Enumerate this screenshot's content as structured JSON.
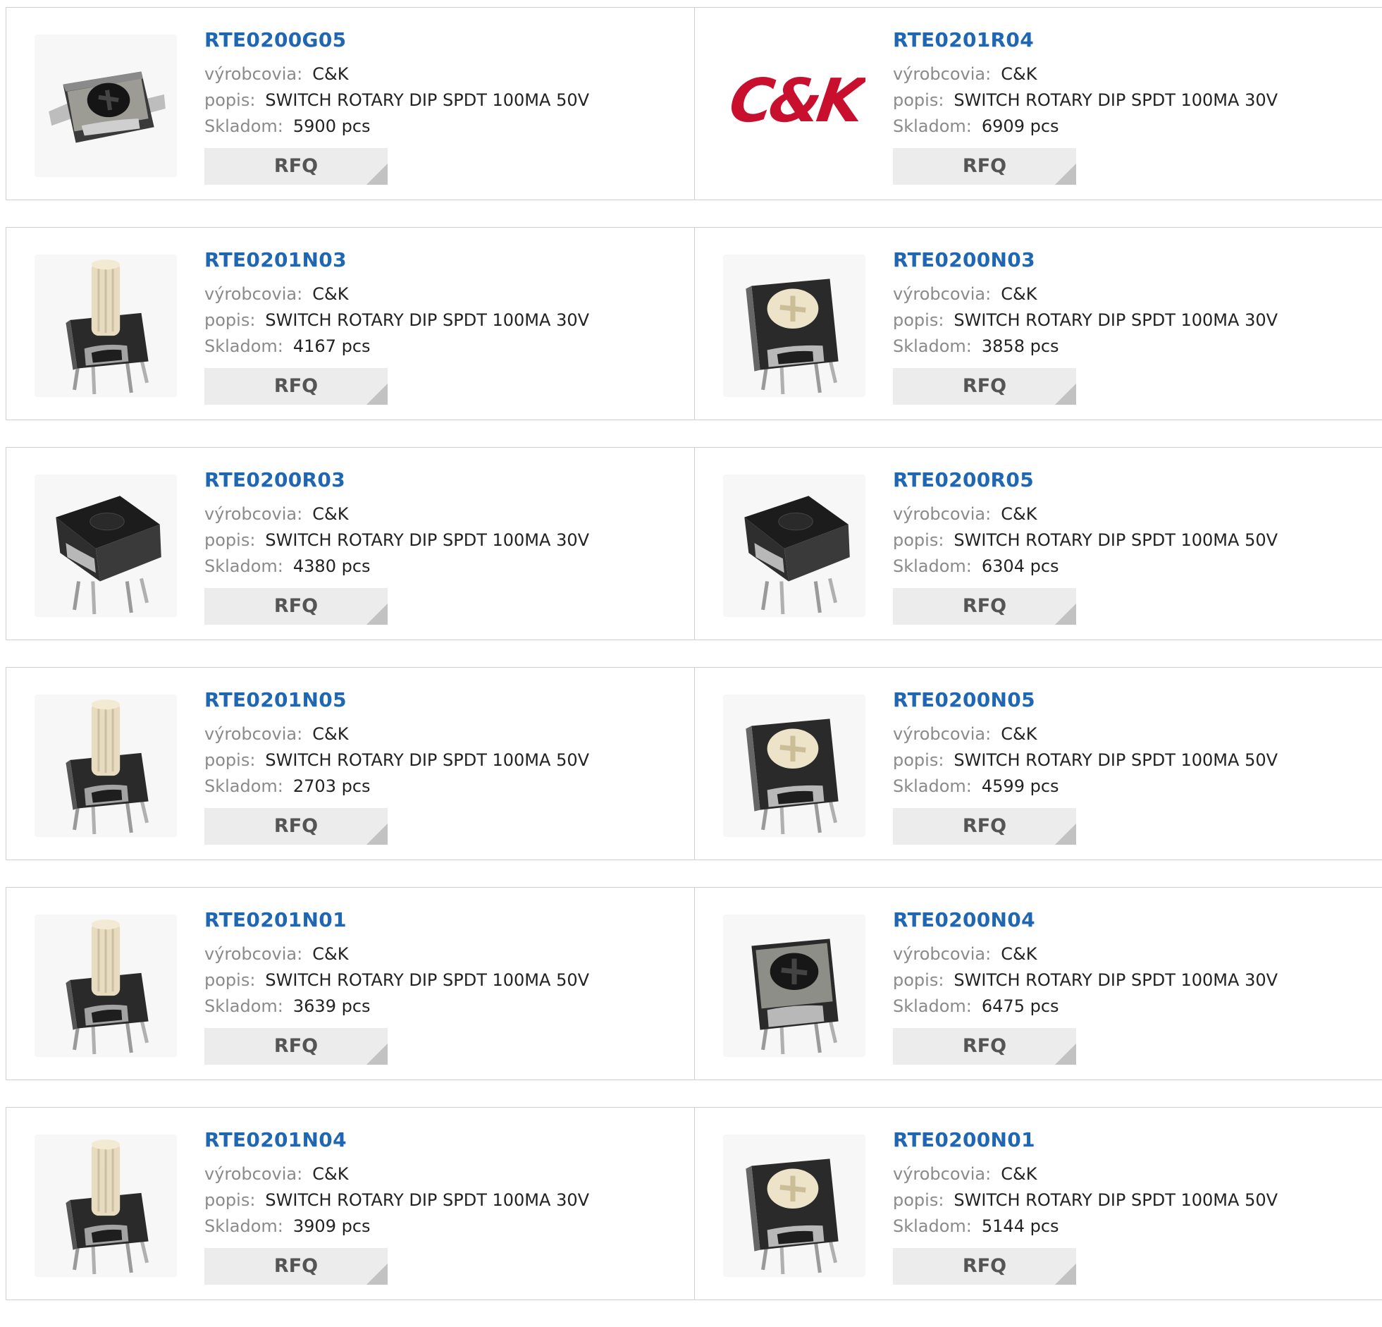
{
  "labels": {
    "manufacturer": "výrobcovia:",
    "description": "popis:",
    "stock": "Skladom:",
    "rfq": "RFQ"
  },
  "colors": {
    "part_link": "#1f66b3",
    "label_gray": "#8a8a8a",
    "button_bg": "#ececec",
    "brand_red": "#c8102e"
  },
  "products": [
    {
      "part": "RTE0200G05",
      "manufacturer": "C&K",
      "description": "SWITCH ROTARY DIP SPDT 100MA 50V",
      "stock": "5900 pcs",
      "image": "smd-switch-dark-knob"
    },
    {
      "part": "RTE0201R04",
      "manufacturer": "C&K",
      "description": "SWITCH ROTARY DIP SPDT 100MA 30V",
      "stock": "6909 pcs",
      "image": "ck-logo",
      "logo_text": "C&K"
    },
    {
      "part": "RTE0201N03",
      "manufacturer": "C&K",
      "description": "SWITCH ROTARY DIP SPDT 100MA 30V",
      "stock": "4167 pcs",
      "image": "tall-shaft-switch"
    },
    {
      "part": "RTE0200N03",
      "manufacturer": "C&K",
      "description": "SWITCH ROTARY DIP SPDT 100MA 30V",
      "stock": "3858 pcs",
      "image": "dip-switch-cream-knob"
    },
    {
      "part": "RTE0200R03",
      "manufacturer": "C&K",
      "description": "SWITCH ROTARY DIP SPDT 100MA 30V",
      "stock": "4380 pcs",
      "image": "dip-switch-black-top"
    },
    {
      "part": "RTE0200R05",
      "manufacturer": "C&K",
      "description": "SWITCH ROTARY DIP SPDT 100MA 50V",
      "stock": "6304 pcs",
      "image": "dip-switch-black-top"
    },
    {
      "part": "RTE0201N05",
      "manufacturer": "C&K",
      "description": "SWITCH ROTARY DIP SPDT 100MA 50V",
      "stock": "2703 pcs",
      "image": "tall-shaft-switch"
    },
    {
      "part": "RTE0200N05",
      "manufacturer": "C&K",
      "description": "SWITCH ROTARY DIP SPDT 100MA 50V",
      "stock": "4599 pcs",
      "image": "dip-switch-cream-knob"
    },
    {
      "part": "RTE0201N01",
      "manufacturer": "C&K",
      "description": "SWITCH ROTARY DIP SPDT 100MA 50V",
      "stock": "3639 pcs",
      "image": "tall-shaft-switch"
    },
    {
      "part": "RTE0200N04",
      "manufacturer": "C&K",
      "description": "SWITCH ROTARY DIP SPDT 100MA 30V",
      "stock": "6475 pcs",
      "image": "dip-switch-dark-knob"
    },
    {
      "part": "RTE0201N04",
      "manufacturer": "C&K",
      "description": "SWITCH ROTARY DIP SPDT 100MA 30V",
      "stock": "3909 pcs",
      "image": "tall-shaft-switch"
    },
    {
      "part": "RTE0200N01",
      "manufacturer": "C&K",
      "description": "SWITCH ROTARY DIP SPDT 100MA 50V",
      "stock": "5144 pcs",
      "image": "dip-switch-cream-knob"
    }
  ]
}
